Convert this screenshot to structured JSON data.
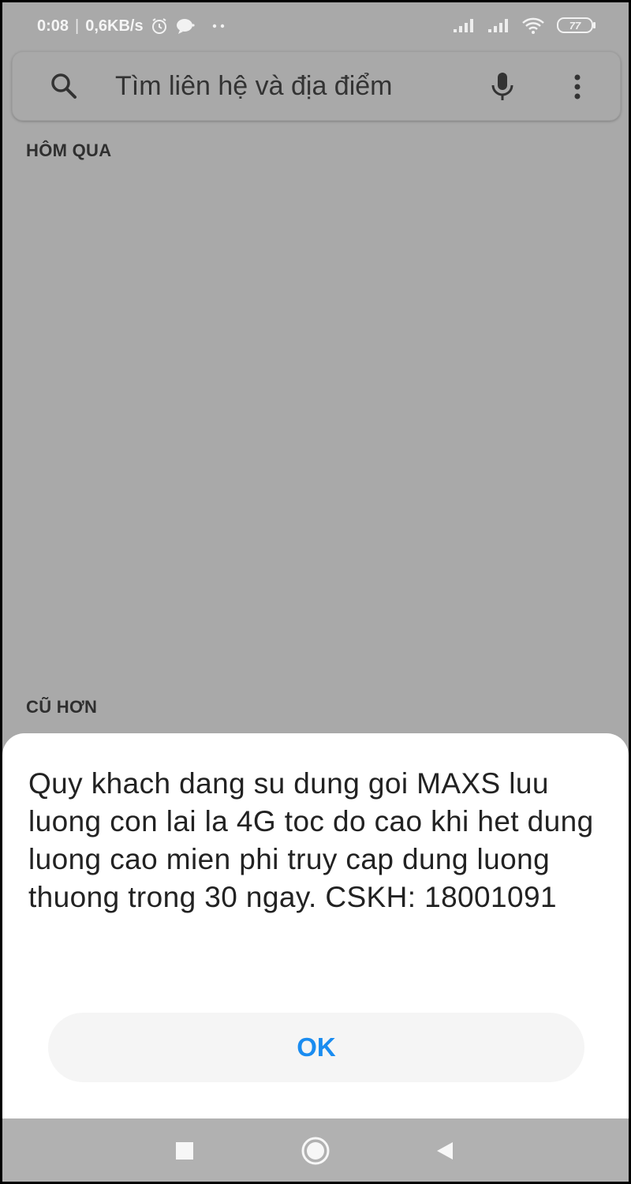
{
  "status_bar": {
    "time": "0:08",
    "separator": "|",
    "speed": "0,6KB/s",
    "battery": "77",
    "icons": [
      "alarm-icon",
      "chat-bubble-icon",
      "more-dots-icon",
      "signal-icon",
      "signal-icon",
      "wifi-icon",
      "battery-icon"
    ]
  },
  "search": {
    "placeholder": "Tìm liên hệ và địa điểm",
    "icons": [
      "search-icon",
      "microphone-icon",
      "more-vert-icon"
    ]
  },
  "sections": {
    "yesterday": "HÔM QUA",
    "older": "CŨ HƠN"
  },
  "dialog": {
    "message": "Quy khach dang su dung goi MAXS luu luong con lai la 4G toc do cao khi het dung luong cao mien phi truy cap dung luong thuong trong 30 ngay. CSKH: 18001091",
    "ok_label": "OK",
    "ok_color": "#1a8cf0"
  },
  "nav_bar": {
    "icons": [
      "recent-apps-icon",
      "home-icon",
      "back-icon"
    ]
  },
  "colors": {
    "dim_background": "#a9a9a9",
    "dialog_background": "#ffffff",
    "button_background": "#f5f5f5"
  }
}
